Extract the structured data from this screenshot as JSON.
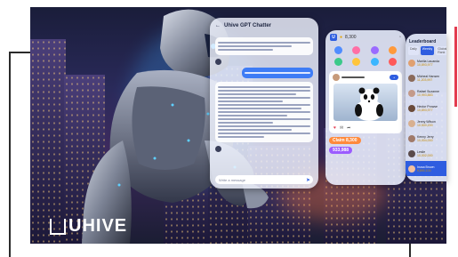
{
  "chat_panel": {
    "title": "Uhive GPT Chatter",
    "input_placeholder": "Write a message"
  },
  "app_panel": {
    "logo_letter": "U",
    "balance": "8,300",
    "coin_label": "Claim 8,300",
    "coin_amount": "933,988"
  },
  "leaderboard": {
    "title": "Leaderboard",
    "tabs": [
      "Daily",
      "Weekly",
      "Global Rank",
      "Hive"
    ],
    "rows": [
      {
        "name": "Marília Lauanda",
        "value": "10,893,977"
      },
      {
        "name": "Micheal Hansen",
        "value": "11,203,997"
      },
      {
        "name": "Rafael Suzanne",
        "value": "10,993,883"
      },
      {
        "name": "Hector Prowse",
        "value": "10,893,977"
      },
      {
        "name": "Jenny Wilson",
        "value": "10,500,200"
      },
      {
        "name": "Kenny Jerry",
        "value": "10,004,000"
      },
      {
        "name": "Leslie",
        "value": "10,002,000"
      },
      {
        "name": "Inusa Brown",
        "value": "9,890,100"
      }
    ]
  },
  "brand": {
    "name": "UHIVE"
  },
  "colors": {
    "accent": "#2e5de0",
    "highlight": "#e33b4f"
  }
}
